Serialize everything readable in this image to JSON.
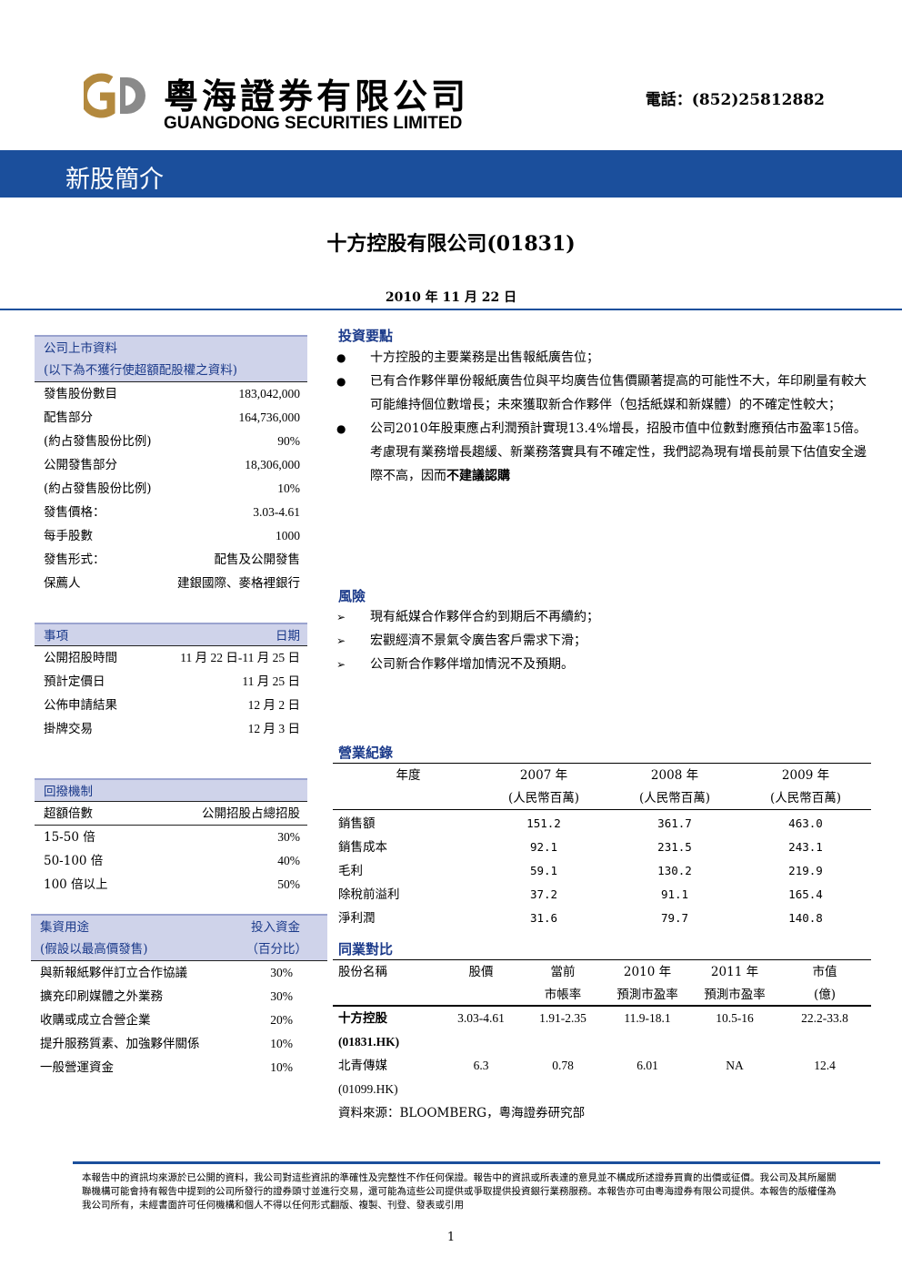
{
  "header": {
    "logo_gd": "GD",
    "logo_cn": "粵海證券有限公司",
    "logo_en": "GUANGDONG SECURITIES LIMITED",
    "phone": "電話：(852)25812882",
    "logo_colors": {
      "gold": "#b3893e",
      "grey": "#888888"
    }
  },
  "banner": {
    "title": "新股簡介",
    "color": "#1b4f9c"
  },
  "title": "十方控股有限公司(01831)",
  "date": "2010 年 11 月 22 日",
  "listing_info": {
    "head1": "公司上市資料",
    "head2": "(以下為不獲行使超額配股權之資料)",
    "rows": [
      {
        "label": "發售股份數目",
        "value": "183,042,000"
      },
      {
        "label": "配售部分",
        "value": "164,736,000"
      },
      {
        "label": "(約占發售股份比例)",
        "value": "90%"
      },
      {
        "label": "公開發售部分",
        "value": "18,306,000"
      },
      {
        "label": "(約占發售股份比例)",
        "value": "10%"
      },
      {
        "label": "發售價格：",
        "value": "3.03-4.61"
      },
      {
        "label": "每手股數",
        "value": "1000"
      },
      {
        "label": "發售形式：",
        "value": "配售及公開發售"
      },
      {
        "label": "保薦人",
        "value": "建銀國際、麥格裡銀行"
      }
    ]
  },
  "schedule": {
    "head_left": "事項",
    "head_right": "日期",
    "rows": [
      {
        "label": "公開招股時間",
        "value": "11 月 22 日-11 月 25 日"
      },
      {
        "label": "預計定價日",
        "value": "11 月 25 日"
      },
      {
        "label": "公佈申請結果",
        "value": "12 月 2 日"
      },
      {
        "label": "掛牌交易",
        "value": "12 月 3 日"
      }
    ]
  },
  "clawback": {
    "head": "回撥機制",
    "sub_left": "超額倍數",
    "sub_right": "公開招股占總招股",
    "rows": [
      {
        "label": "15-50 倍",
        "value": "30%"
      },
      {
        "label": "50-100 倍",
        "value": "40%"
      },
      {
        "label": "100 倍以上",
        "value": "50%"
      }
    ]
  },
  "use_of_funds": {
    "head_left1": "集資用途",
    "head_left2": "(假設以最高價發售)",
    "head_right1": "投入資金",
    "head_right2": "（百分比）",
    "rows": [
      {
        "label": "與新報紙夥伴訂立合作協議",
        "value": "30%"
      },
      {
        "label": "擴充印刷媒體之外業務",
        "value": "30%"
      },
      {
        "label": "收購或成立合營企業",
        "value": "20%"
      },
      {
        "label": "提升服務質素、加強夥伴關係",
        "value": "10%"
      },
      {
        "label": "一般營運資金",
        "value": "10%"
      }
    ]
  },
  "highlights": {
    "title": "投資要點",
    "bullet_marker": "●",
    "items": [
      "十方控股的主要業務是出售報紙廣告位；",
      "已有合作夥伴單份報紙廣告位與平均廣告位售價顯著提高的可能性不大，年印刷量有較大可能維持個位數增長；未來獲取新合作夥伴（包括紙媒和新媒體）的不確定性較大；",
      "公司2010年股東應占利潤預計實現13.4%增長，招股市值中位數對應預估市盈率15倍。考慮現有業務增長趨緩、新業務落實具有不確定性，我們認為現有增長前景下估值安全邊際不高，因而"
    ],
    "conclusion": "不建議認購"
  },
  "risks": {
    "title": "風險",
    "bullet_marker": "➢",
    "items": [
      "現有紙媒合作夥伴合約到期后不再續約；",
      "宏觀經濟不景氣令廣告客戶需求下滑；",
      "公司新合作夥伴增加情況不及預期。"
    ]
  },
  "business_record": {
    "title": "營業紀錄",
    "header": [
      "年度",
      "2007 年",
      "2008 年",
      "2009 年"
    ],
    "subheader": [
      "",
      "(人民幣百萬)",
      "(人民幣百萬)",
      "(人民幣百萬)"
    ],
    "rows": [
      [
        "銷售額",
        "151.2",
        "361.7",
        "463.0"
      ],
      [
        "銷售成本",
        "92.1",
        "231.5",
        "243.1"
      ],
      [
        "毛利",
        "59.1",
        "130.2",
        "219.9"
      ],
      [
        "除稅前溢利",
        "37.2",
        "91.1",
        "165.4"
      ],
      [
        "淨利潤",
        "31.6",
        "79.7",
        "140.8"
      ]
    ]
  },
  "peer_compare": {
    "title": "同業對比",
    "header1": [
      "股份名稱",
      "股價",
      "當前",
      "2010 年",
      "2011 年",
      "市值"
    ],
    "header2": [
      "",
      "",
      "市帳率",
      "預測市盈率",
      "預測市盈率",
      "(億)"
    ],
    "rows": [
      {
        "name": "十方控股",
        "code": "(01831.HK)",
        "values": [
          "3.03-4.61",
          "1.91-2.35",
          "11.9-18.1",
          "10.5-16",
          "22.2-33.8"
        ],
        "bold": true
      },
      {
        "name": "北青傳媒",
        "code": "(01099.HK)",
        "values": [
          "6.3",
          "0.78",
          "6.01",
          "NA",
          "12.4"
        ],
        "bold": false
      }
    ],
    "source": "資料來源：BLOOMBERG，粵海證券研究部"
  },
  "disclaimer": "本報告中的資訊均來源於已公開的資料，我公司對這些資訊的準確性及完整性不作任何保證。報告中的資訊或所表達的意見並不構成所述證券買賣的出價或征價。我公司及其所屬關聯機構可能會持有報告中提到的公司所發行的證券頭寸並進行交易，還可能為這些公司提供或爭取提供投資銀行業務服務。本報告亦可由粵海證券有限公司提供。本報告的版權僅為我公司所有，未經書面許可任何機構和個人不得以任何形式翻版、複製、刊登、發表或引用",
  "page_number": "1"
}
